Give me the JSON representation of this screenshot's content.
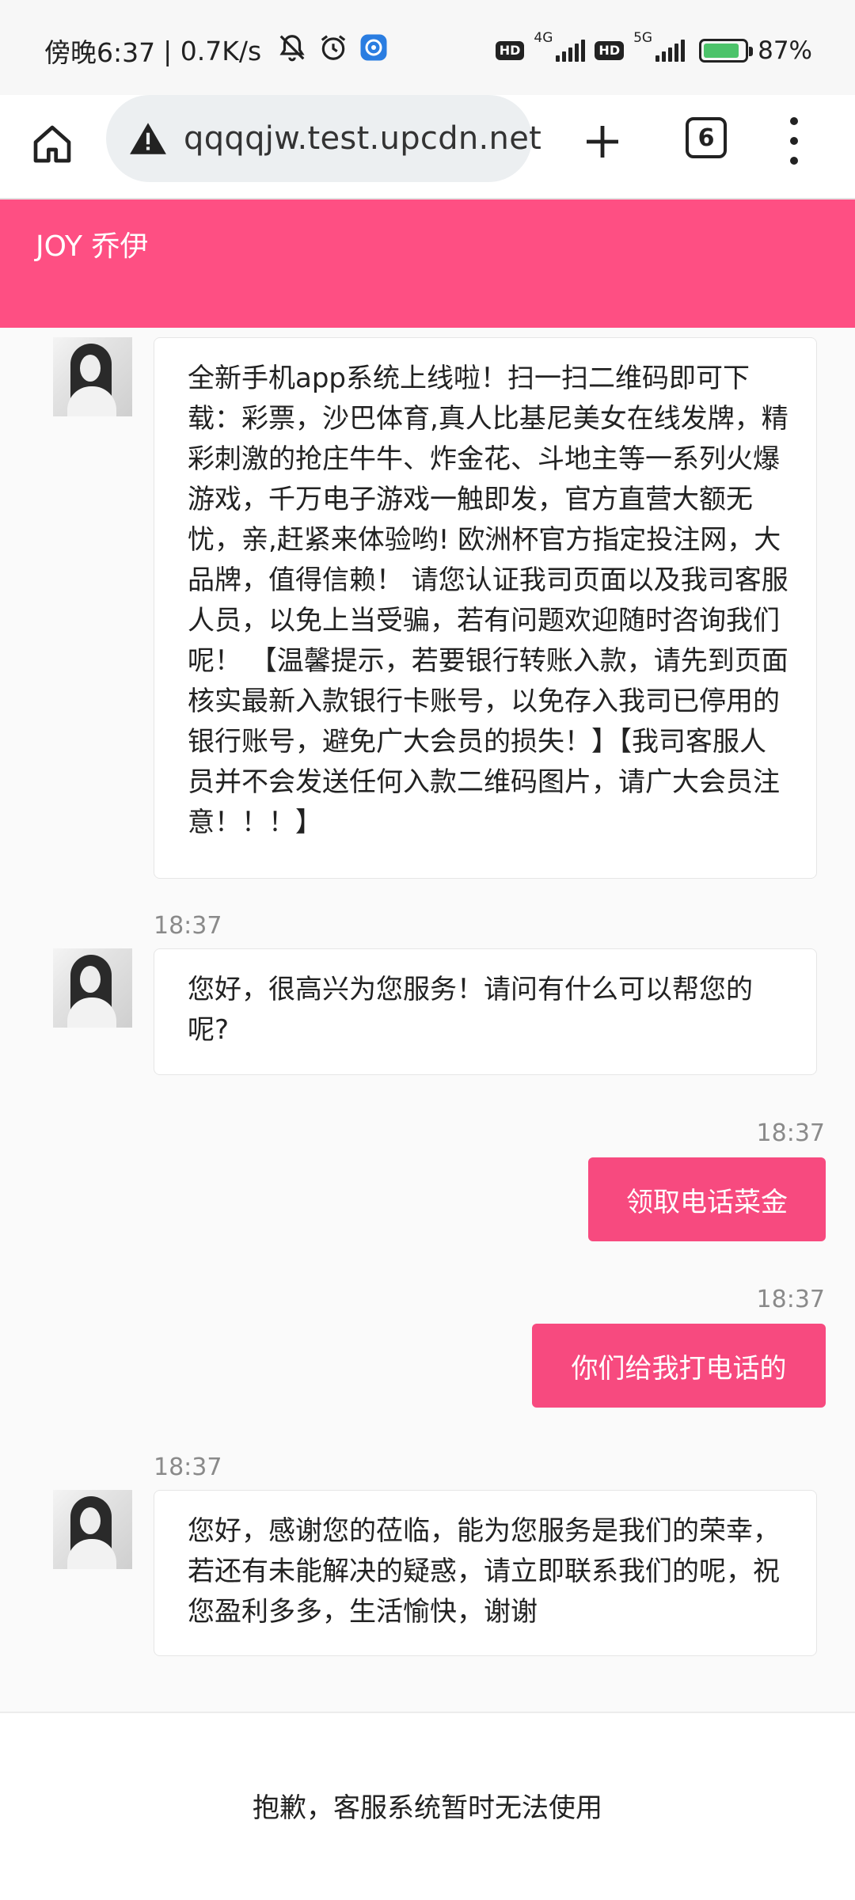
{
  "status_bar": {
    "time": "傍晚6:37",
    "speed": "| 0.7K/s",
    "sim1_badge": "HD",
    "sim1_network": "4G",
    "sim2_badge": "HD",
    "sim2_network": "5G",
    "battery": "87%",
    "battery_level": 0.87
  },
  "browser": {
    "url": "qqqqjw.test.upcdn.net",
    "tab_count": "6"
  },
  "chat": {
    "title": "JOY 乔伊",
    "messages": [
      {
        "direction": "in",
        "time": "",
        "text": "全新手机app系统上线啦！扫一扫二维码即可下载：彩票，沙巴体育,真人比基尼美女在线发牌，精彩刺激的抢庄牛牛、炸金花、斗地主等一系列火爆游戏，千万电子游戏一触即发，官方直营大额无忧，亲,赶紧来体验哟! 欧洲杯官方指定投注网，大品牌，值得信赖！ 请您认证我司页面以及我司客服人员，以免上当受骗，若有问题欢迎随时咨询我们呢！ 【温馨提示，若要银行转账入款，请先到页面核实最新入款银行卡账号，以免存入我司已停用的银行账号，避免广大会员的损失！】【我司客服人员并不会发送任何入款二维码图片，请广大会员注意！！！】"
      },
      {
        "direction": "in",
        "time": "18:37",
        "text": "您好，很高兴为您服务！请问有什么可以帮您的呢?"
      },
      {
        "direction": "out",
        "time": "18:37",
        "text": "领取电话菜金"
      },
      {
        "direction": "out",
        "time": "18:37",
        "text": "你们给我打电话的"
      },
      {
        "direction": "in",
        "time": "18:37",
        "text": "您好，感谢您的莅临，能为您服务是我们的荣幸，若还有未能解决的疑惑，请立即联系我们的呢，祝您盈利多多，生活愉快，谢谢"
      }
    ]
  },
  "footer": {
    "notice": "抱歉，客服系统暂时无法使用"
  },
  "colors": {
    "header": "#fe4f83",
    "outgoing_bubble": "#f74a7f"
  }
}
